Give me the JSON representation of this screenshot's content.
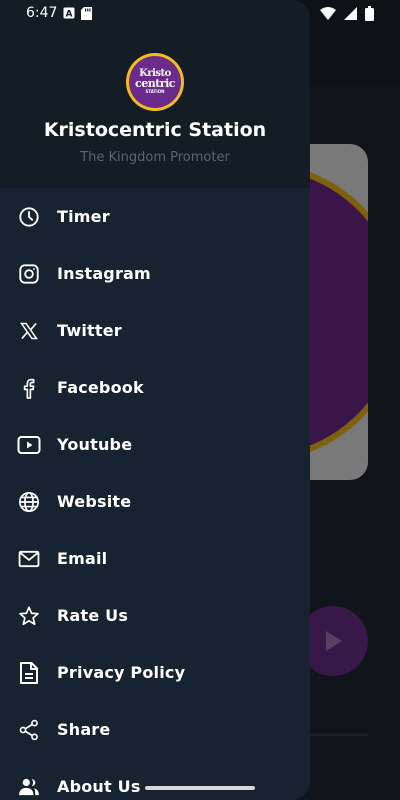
{
  "status_bar": {
    "time": "6:47",
    "icons": [
      "text-notification-icon",
      "sd-card-icon",
      "wifi-icon",
      "signal-icon",
      "battery-icon"
    ]
  },
  "drawer": {
    "station_name": "Kristocentric Station",
    "tagline": "The Kingdom Promoter",
    "logo_text": [
      "Kristo",
      "centric",
      "STATION"
    ],
    "items": [
      {
        "label": "Timer",
        "icon": "clock-icon"
      },
      {
        "label": "Instagram",
        "icon": "instagram-icon"
      },
      {
        "label": "Twitter",
        "icon": "x-twitter-icon"
      },
      {
        "label": "Facebook",
        "icon": "facebook-icon"
      },
      {
        "label": "Youtube",
        "icon": "youtube-icon"
      },
      {
        "label": "Website",
        "icon": "globe-icon"
      },
      {
        "label": "Email",
        "icon": "email-icon"
      },
      {
        "label": "Rate Us",
        "icon": "star-icon"
      },
      {
        "label": "Privacy Policy",
        "icon": "document-icon"
      },
      {
        "label": "Share",
        "icon": "share-icon"
      },
      {
        "label": "About Us",
        "icon": "people-icon"
      }
    ]
  },
  "colors": {
    "drawer_bg": "#172330",
    "header_bg": "#141c26",
    "brand_purple": "#6a2b8c",
    "brand_gold": "#f2bc1d"
  }
}
